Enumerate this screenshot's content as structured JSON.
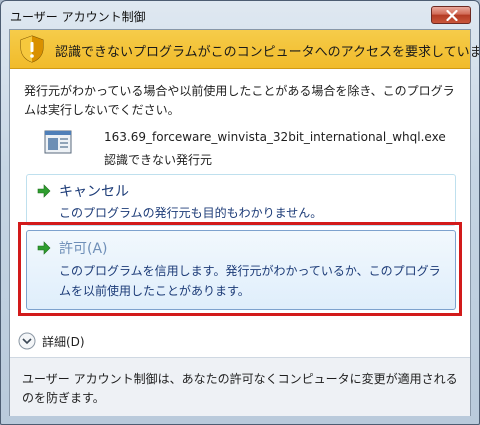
{
  "window": {
    "title": "ユーザー アカウント制御"
  },
  "banner": {
    "text": "認識できないプログラムがこのコンピュータへのアクセスを要求しています",
    "color": "#f3c232"
  },
  "message": {
    "text": "発行元がわかっている場合や以前使用したことがある場合を除き、このプログラムは実行しないでください。"
  },
  "program": {
    "file_name": "163.69_forceware_winvista_32bit_international_whql.exe",
    "publisher": "認識できない発行元"
  },
  "options": {
    "cancel": {
      "title": "キャンセル",
      "description": "このプログラムの発行元も目的もわかりません。"
    },
    "allow": {
      "title": "許可(A)",
      "description": "このプログラムを信用します。発行元がわかっているか、このプログラムを以前使用したことがあります。"
    }
  },
  "details": {
    "label": "詳細(D)"
  },
  "footer": {
    "text": "ユーザー アカウント制御は、あなたの許可なくコンピュータに変更が適用されるのを防ぎます。"
  },
  "colors": {
    "highlight_border": "#d21a1a",
    "option_text": "#1c3b77",
    "arrow_green": "#2f9e2f"
  },
  "icons": [
    "shield-warning-icon",
    "program-file-icon",
    "green-arrow-icon",
    "chevron-down-icon",
    "close-icon"
  ]
}
